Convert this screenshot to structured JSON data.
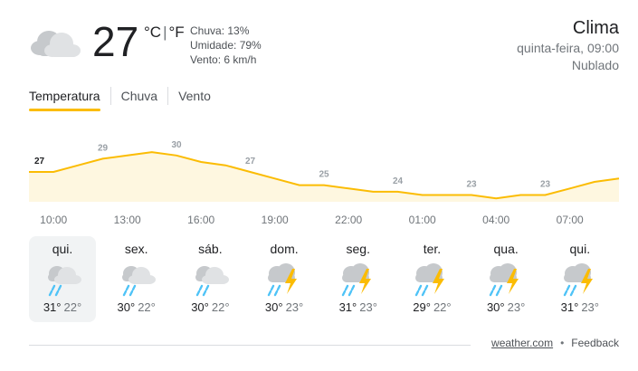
{
  "current": {
    "temp": "27",
    "unit_c": "°C",
    "unit_f": "°F",
    "unit_sep": "|",
    "precip": "Chuva: 13%",
    "humidity": "Umidade: 79%",
    "wind": "Vento: 6 km/h",
    "icon": "cloudy-icon"
  },
  "header": {
    "title": "Clima",
    "datetime": "quinta-feira, 09:00",
    "condition": "Nublado"
  },
  "tabs": [
    {
      "label": "Temperatura",
      "active": true
    },
    {
      "label": "Chuva",
      "active": false
    },
    {
      "label": "Vento",
      "active": false
    }
  ],
  "colors": {
    "accent": "#fbbc04",
    "area_fill": "#fef7e0",
    "rain": "#4fc3f7",
    "bolt": "#fbbc04",
    "cloud": "#dadce0"
  },
  "chart_data": {
    "type": "area",
    "series": [
      {
        "x": [
          "09:00",
          "10:00",
          "11:00",
          "12:00",
          "13:00",
          "14:00",
          "15:00",
          "16:00",
          "17:00",
          "18:00",
          "19:00",
          "20:00",
          "21:00",
          "22:00",
          "23:00",
          "00:00",
          "01:00",
          "02:00",
          "03:00",
          "04:00",
          "05:00",
          "06:00",
          "07:00",
          "08:00",
          "09:00"
        ],
        "values": [
          27,
          27,
          28,
          29,
          29.5,
          30,
          29.5,
          28.5,
          28,
          27,
          26,
          25,
          25,
          24.5,
          24,
          24,
          23.5,
          23.5,
          23.5,
          23,
          23.5,
          23.5,
          24.5,
          25.5,
          26
        ]
      }
    ],
    "point_labels": [
      {
        "x": "09:00",
        "text": "27"
      },
      {
        "x": "12:00",
        "text": "29"
      },
      {
        "x": "15:00",
        "text": "30"
      },
      {
        "x": "18:00",
        "text": "27"
      },
      {
        "x": "21:00",
        "text": "25"
      },
      {
        "x": "00:00",
        "text": "24"
      },
      {
        "x": "03:00",
        "text": "23"
      },
      {
        "x": "06:00",
        "text": "23"
      }
    ],
    "time_labels": [
      "10:00",
      "13:00",
      "16:00",
      "19:00",
      "22:00",
      "01:00",
      "04:00",
      "07:00"
    ]
  },
  "days": [
    {
      "name": "qui.",
      "hi": "31°",
      "lo": "22°",
      "icon": "cloudy-rain-icon",
      "selected": true
    },
    {
      "name": "sex.",
      "hi": "30°",
      "lo": "22°",
      "icon": "cloudy-rain-icon",
      "selected": false
    },
    {
      "name": "sáb.",
      "hi": "30°",
      "lo": "22°",
      "icon": "cloudy-rain-icon",
      "selected": false
    },
    {
      "name": "dom.",
      "hi": "30°",
      "lo": "23°",
      "icon": "thunderstorm-icon",
      "selected": false
    },
    {
      "name": "seg.",
      "hi": "31°",
      "lo": "23°",
      "icon": "thunderstorm-icon",
      "selected": false
    },
    {
      "name": "ter.",
      "hi": "29°",
      "lo": "22°",
      "icon": "thunderstorm-icon",
      "selected": false
    },
    {
      "name": "qua.",
      "hi": "30°",
      "lo": "23°",
      "icon": "thunderstorm-icon",
      "selected": false
    },
    {
      "name": "qui.",
      "hi": "31°",
      "lo": "23°",
      "icon": "thunderstorm-icon",
      "selected": false
    }
  ],
  "footer": {
    "source": "weather.com",
    "separator": "•",
    "feedback": "Feedback"
  }
}
